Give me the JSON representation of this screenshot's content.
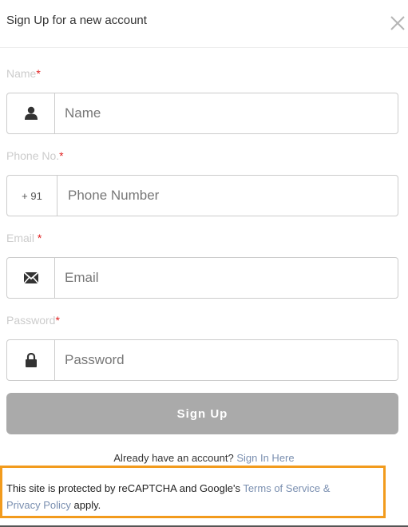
{
  "modal": {
    "title": "Sign Up for a new account",
    "close_icon": "close-icon"
  },
  "form": {
    "name": {
      "label": "Name",
      "required_mark": "*",
      "placeholder": "Name",
      "value": "",
      "icon": "user-icon"
    },
    "phone": {
      "label": "Phone No.",
      "required_mark": "*",
      "country_code": "+ 91",
      "placeholder": "Phone Number",
      "value": ""
    },
    "email": {
      "label": "Email ",
      "required_mark": "*",
      "placeholder": "Email",
      "value": "",
      "icon": "envelope-icon"
    },
    "password": {
      "label": "Password",
      "required_mark": "*",
      "placeholder": "Password",
      "value": "",
      "icon": "lock-icon"
    },
    "submit_label": "Sign Up"
  },
  "signin": {
    "prompt": "Already have an account?",
    "link": "Sign In Here"
  },
  "recaptcha": {
    "text_before": "This site is protected by reCAPTCHA and Google's ",
    "terms_link": "Terms of Service &",
    "privacy_link": "Privacy Policy",
    "text_after": " apply."
  },
  "colors": {
    "required": "#e02020",
    "button_bg": "#aaaaaa",
    "link": "#7a8fb0",
    "highlight_border": "#f29b1d"
  }
}
